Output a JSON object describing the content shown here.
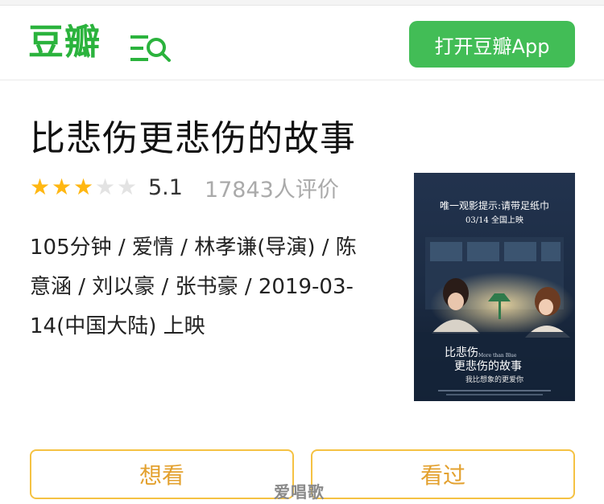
{
  "header": {
    "logo_text": "豆瓣",
    "open_app_label": "打开豆瓣App"
  },
  "movie": {
    "title": "比悲伤更悲伤的故事",
    "rating_score": "5.1",
    "rating_stars": 3,
    "rating_count": "17843人评价",
    "meta_lines": [
      "105分钟 / 爱情 / 林孝谦(导演) / 陈",
      "意涵 / 刘以豪 / 张书豪 / 2019-03-",
      "14(中国大陆) 上映"
    ]
  },
  "poster": {
    "tagline": "唯一观影提示:请带足纸巾",
    "release": "03/14 全国上映",
    "title_line1": "比悲伤",
    "title_line2": "更悲伤的故事",
    "subtitle": "我比想象的更爱你",
    "english": "More than Blue"
  },
  "actions": {
    "want_label": "想看",
    "seen_label": "看过"
  },
  "watermark": "爱唱歌",
  "colors": {
    "brand_green": "#2bb33d",
    "button_green": "#42bd56",
    "star_on": "#ffb712",
    "action_border": "#f5c243",
    "action_text": "#e3a12f"
  }
}
